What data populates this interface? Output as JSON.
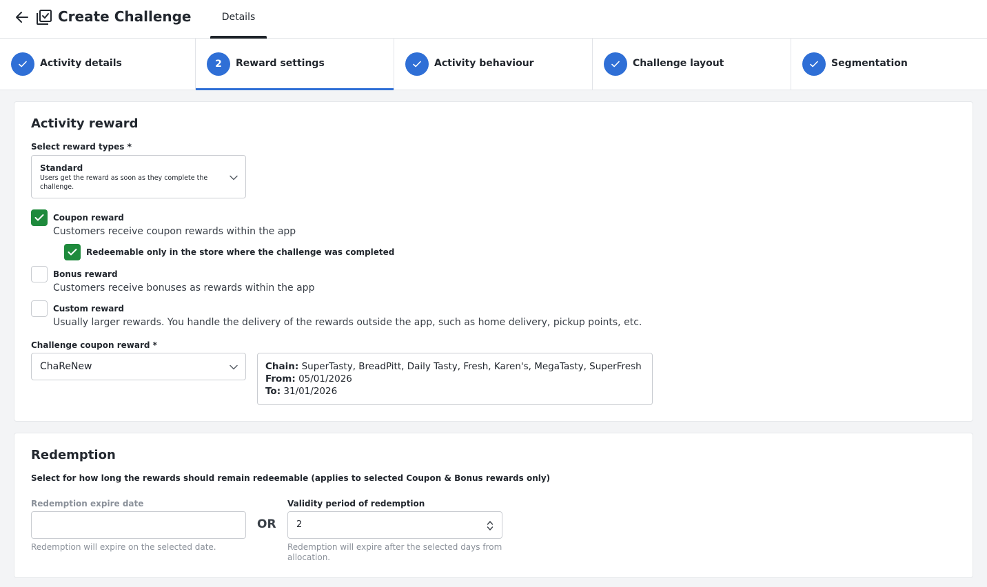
{
  "header": {
    "title": "Create Challenge",
    "back_icon": "arrow-left-icon",
    "title_icon": "checklist-icon",
    "tab_label": "Details"
  },
  "steps": [
    {
      "label": "Activity details",
      "state": "completed",
      "number": ""
    },
    {
      "label": "Reward settings",
      "state": "active",
      "number": "2"
    },
    {
      "label": "Activity behaviour",
      "state": "completed",
      "number": ""
    },
    {
      "label": "Challenge layout",
      "state": "completed",
      "number": ""
    },
    {
      "label": "Segmentation",
      "state": "completed",
      "number": ""
    }
  ],
  "activity_reward": {
    "title": "Activity reward",
    "reward_types_label": "Select reward types *",
    "reward_type_selected": "Standard",
    "reward_type_desc_line1": "Users get the reward as soon as they complete the",
    "reward_type_desc_line2": "challenge.",
    "coupon": {
      "title": "Coupon reward",
      "desc": "Customers receive coupon rewards within the app",
      "checked": true
    },
    "store_only": {
      "title": "Redeemable only in the store where the challenge was completed",
      "checked": true
    },
    "bonus": {
      "title": "Bonus reward",
      "desc": "Customers receive bonuses as rewards within the app",
      "checked": false
    },
    "custom": {
      "title": "Custom reward",
      "desc": "Usually larger rewards. You handle the delivery of the rewards outside the app, such as home delivery, pickup points, etc.",
      "checked": false
    },
    "coupon_select_label": "Challenge coupon reward *",
    "coupon_select_value": "ChaReNew",
    "info": {
      "chain_label": "Chain:",
      "chain_value": "SuperTasty, BreadPitt, Daily Tasty, Fresh, Karen's, MegaTasty, SuperFresh",
      "from_label": "From:",
      "from_value": "05/01/2026",
      "to_label": "To:",
      "to_value": "31/01/2026"
    }
  },
  "redemption": {
    "title": "Redemption",
    "subtitle": "Select for how long the rewards should remain redeemable (applies to selected Coupon & Bonus rewards only)",
    "expire_label": "Redemption expire date",
    "expire_value": "",
    "expire_helper": "Redemption will expire on the selected date.",
    "or_text": "OR",
    "validity_label": "Validity period of redemption",
    "validity_value": "2",
    "validity_helper_line1": "Redemption will expire after the selected days from",
    "validity_helper_line2": "allocation."
  },
  "colors": {
    "accent": "#2f6fd6",
    "check_green": "#1e8a3c"
  }
}
